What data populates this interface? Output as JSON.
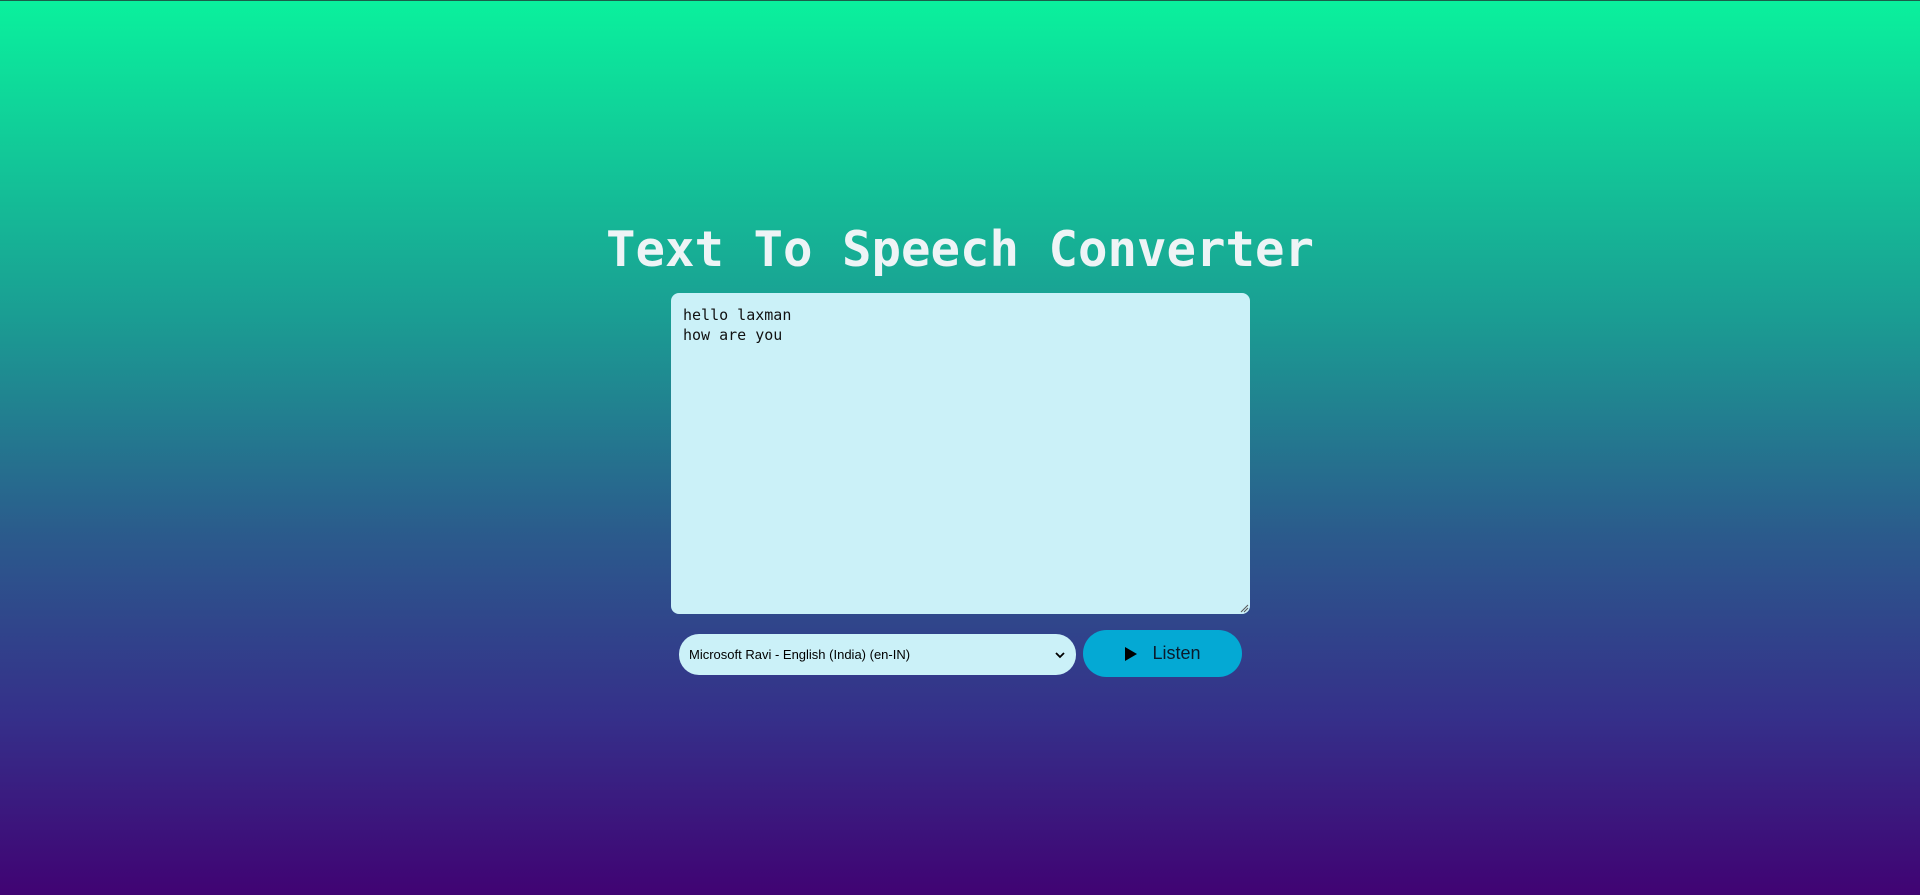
{
  "page": {
    "title": "Text To Speech Converter"
  },
  "editor": {
    "text": "hello laxman\nhow are you"
  },
  "voice_select": {
    "selected": "Microsoft Ravi - English (India) (en-IN)",
    "icon": "chevron-down-icon"
  },
  "listen_button": {
    "label": "Listen",
    "icon": "play-icon"
  },
  "colors": {
    "gradient_top": "#0af19d",
    "gradient_bottom": "#400373",
    "input_bg": "#cbf1f8",
    "button_bg": "#04a9d4",
    "title_color": "#eef4f6"
  }
}
